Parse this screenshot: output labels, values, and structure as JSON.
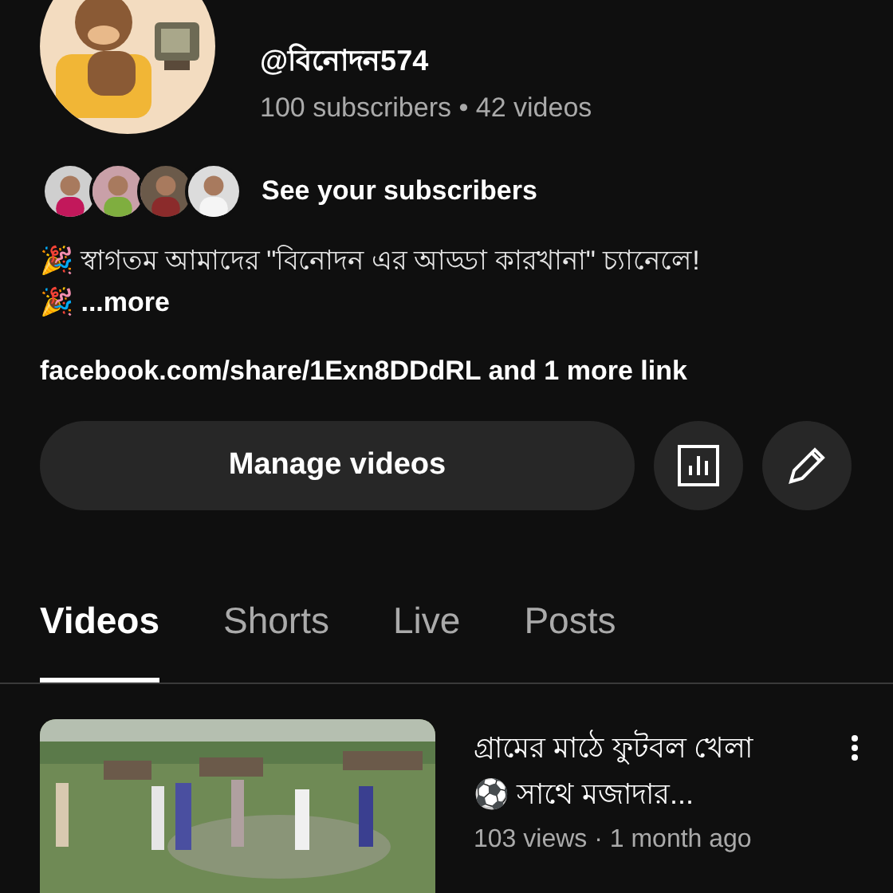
{
  "channel": {
    "handle": "@বিনোদন574",
    "stats": "100 subscribers • 42 videos"
  },
  "subscribers": {
    "label": "See your subscribers"
  },
  "description": {
    "lines": [
      "🎉 স্বাগতম আমাদের \"বিনোদন এর আড্ডা কারখানা\" চ্যানেলে!",
      "🎉 ...more"
    ]
  },
  "link": "facebook.com/share/1Exn8DDdRL and 1 more link",
  "manage_button": "Manage videos",
  "tabs": [
    {
      "label": "Videos",
      "selected": true
    },
    {
      "label": "Shorts",
      "selected": false
    },
    {
      "label": "Live",
      "selected": false
    },
    {
      "label": "Posts",
      "selected": false
    }
  ],
  "videos": [
    {
      "title": "গ্রামের মাঠে ফুটবল খেলা ⚽ সাথে মজাদার...",
      "meta": "103 views · 1 month ago"
    }
  ]
}
